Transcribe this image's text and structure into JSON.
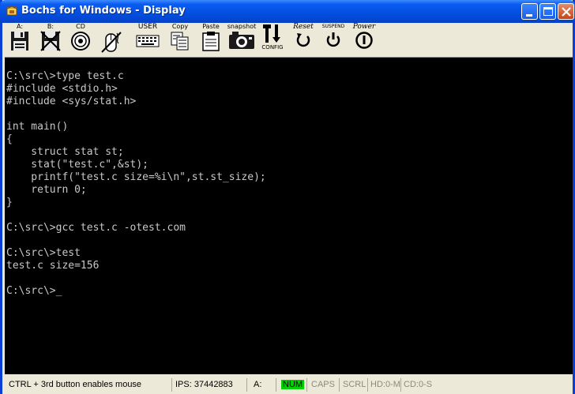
{
  "window": {
    "title": "Bochs for Windows - Display",
    "controls": [
      "minimize-icon",
      "maximize-icon",
      "close-icon"
    ]
  },
  "toolbar": {
    "floppy_a": "A:",
    "floppy_b": "B:",
    "cdrom": "CD",
    "mouse": "",
    "user": "USER",
    "copy": "Copy",
    "paste": "Paste",
    "snapshot": "snapshot",
    "config": "CONFIG",
    "reset": "Reset",
    "suspend": "SUSPEND",
    "power": "Power"
  },
  "terminal": {
    "lines": [
      "C:\\src\\>type test.c",
      "#include <stdio.h>",
      "#include <sys/stat.h>",
      "",
      "int main()",
      "{",
      "    struct stat st;",
      "    stat(\"test.c\",&st);",
      "    printf(\"test.c size=%i\\n\",st.st_size);",
      "    return 0;",
      "}",
      "",
      "C:\\src\\>gcc test.c -otest.com",
      "",
      "C:\\src\\>test",
      "test.c size=156",
      "",
      "C:\\src\\>"
    ],
    "cursor": "_"
  },
  "statusbar": {
    "hint": "CTRL + 3rd button enables mouse",
    "ips": "IPS:  37442883",
    "drive_a": "A:",
    "num": "NUM",
    "caps": "CAPS",
    "scrl": "SCRL",
    "hd": "HD:0-M",
    "cd": "CD:0-S"
  },
  "colors": {
    "title_bar": "#0350E0",
    "screen_bg": "#000000",
    "screen_text": "#C8C8C8",
    "num_indicator": "#00D000"
  }
}
